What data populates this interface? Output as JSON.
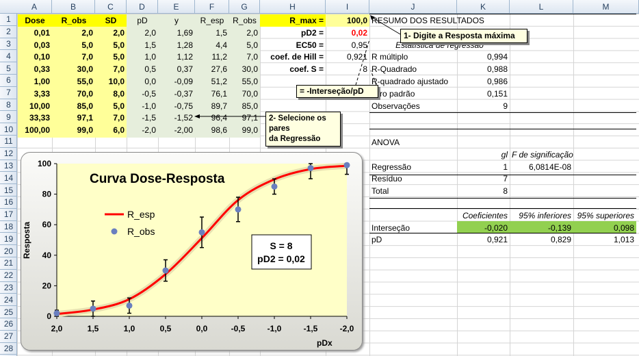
{
  "columns": [
    "A",
    "B",
    "C",
    "D",
    "E",
    "F",
    "G",
    "H",
    "I",
    "J",
    "K",
    "L",
    "M"
  ],
  "rows": [
    "1",
    "2",
    "3",
    "4",
    "5",
    "6",
    "7",
    "8",
    "9",
    "10",
    "11",
    "12",
    "13",
    "14",
    "15",
    "16",
    "17",
    "18",
    "19",
    "20",
    "21",
    "22",
    "23",
    "24",
    "25",
    "26",
    "27",
    "28",
    "29"
  ],
  "headers": {
    "dose": "Dose",
    "r_obs": "R_obs",
    "sd": "SD",
    "pd": "pD",
    "y": "y",
    "r_esp": "R_esp",
    "r_obs2": "R_obs"
  },
  "table": [
    [
      "0,01",
      "2,0",
      "2,0",
      "2,0",
      "1,69",
      "1,5",
      "2,0"
    ],
    [
      "0,03",
      "5,0",
      "5,0",
      "1,5",
      "1,28",
      "4,4",
      "5,0"
    ],
    [
      "0,10",
      "7,0",
      "5,0",
      "1,0",
      "1,12",
      "11,2",
      "7,0"
    ],
    [
      "0,33",
      "30,0",
      "7,0",
      "0,5",
      "0,37",
      "27,6",
      "30,0"
    ],
    [
      "1,00",
      "55,0",
      "10,0",
      "0,0",
      "-0,09",
      "51,2",
      "55,0"
    ],
    [
      "3,33",
      "70,0",
      "8,0",
      "-0,5",
      "-0,37",
      "76,1",
      "70,0"
    ],
    [
      "10,00",
      "85,0",
      "5,0",
      "-1,0",
      "-0,75",
      "89,7",
      "85,0"
    ],
    [
      "33,33",
      "97,1",
      "7,0",
      "-1,5",
      "-1,52",
      "96,4",
      "97,1"
    ],
    [
      "100,00",
      "99,0",
      "6,0",
      "-2,0",
      "-2,00",
      "98,6",
      "99,0"
    ]
  ],
  "params": [
    {
      "label": "R_max =",
      "value": "100,0"
    },
    {
      "label": "pD2 =",
      "value": "0,02"
    },
    {
      "label": "EC50 =",
      "value": "0,95"
    },
    {
      "label": "coef. de Hill =",
      "value": "0,921"
    },
    {
      "label": "coef. S =",
      "value": "8"
    }
  ],
  "notes": {
    "n1": "1- Digite a Resposta máxima",
    "n2": "= -Interseção/pD",
    "n3a": "2- Selecione os pares",
    "n3b": "da Regressão"
  },
  "summary": {
    "title": "RESUMO DOS RESULTADOS",
    "reg_title": "Estatística de regressão",
    "reg": [
      [
        "R múltiplo",
        "0,994"
      ],
      [
        "R-Quadrado",
        "0,988"
      ],
      [
        "R-quadrado ajustado",
        "0,986"
      ],
      [
        "Erro padrão",
        "0,151"
      ],
      [
        "Observações",
        "9"
      ]
    ],
    "anova": "ANOVA",
    "anova_hdr": [
      "gl",
      "F de significação"
    ],
    "anova_rows": [
      [
        "Regressão",
        "1",
        "6,0814E-08"
      ],
      [
        "Resíduo",
        "7",
        ""
      ],
      [
        "Total",
        "8",
        ""
      ]
    ],
    "coef_hdr": [
      "Coeficientes",
      "95% inferiores",
      "95% superiores"
    ],
    "coef_rows": [
      [
        "Interseção",
        "-0,020",
        "-0,139",
        "0,098"
      ],
      [
        "pD",
        "0,921",
        "0,829",
        "1,013"
      ]
    ]
  },
  "chart_data": {
    "type": "line",
    "title": "Curva Dose-Resposta",
    "xlabel": "pDx",
    "ylabel": "Resposta",
    "xlim": [
      2.0,
      -2.0
    ],
    "ylim": [
      0,
      100
    ],
    "xticks": [
      "2,0",
      "1,5",
      "1,0",
      "0,5",
      "0,0",
      "-0,5",
      "-1,0",
      "-1,5",
      "-2,0"
    ],
    "yticks": [
      "0",
      "20",
      "40",
      "60",
      "80",
      "100"
    ],
    "series": [
      {
        "name": "R_esp",
        "type": "line",
        "color": "#ff0000",
        "x": [
          2.0,
          1.5,
          1.0,
          0.5,
          0.0,
          -0.5,
          -1.0,
          -1.5,
          -2.0
        ],
        "y": [
          1.5,
          4.4,
          11.2,
          27.6,
          51.2,
          76.1,
          89.7,
          96.4,
          98.6
        ]
      },
      {
        "name": "R_obs",
        "type": "scatter",
        "color": "#6a7fbf",
        "x": [
          2.0,
          1.5,
          1.0,
          0.5,
          0.0,
          -0.5,
          -1.0,
          -1.5,
          -2.0
        ],
        "y": [
          2,
          5,
          7,
          30,
          55,
          70,
          85,
          97.1,
          99
        ],
        "err": [
          2,
          5,
          5,
          7,
          10,
          8,
          5,
          7,
          6
        ]
      }
    ],
    "annotation": [
      "S = 8",
      "pD2 = 0,02"
    ]
  }
}
